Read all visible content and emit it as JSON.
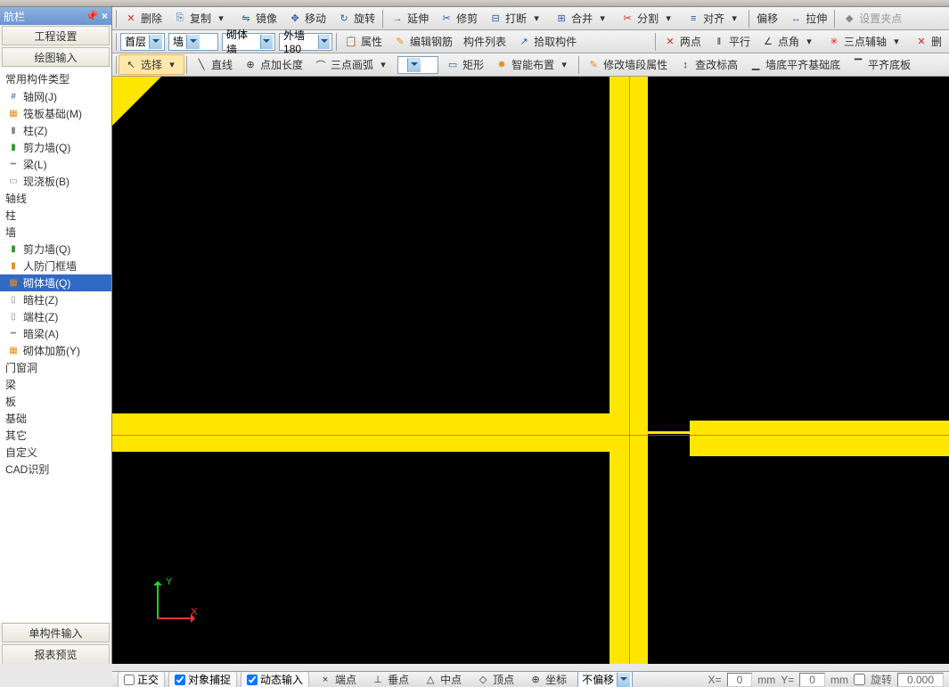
{
  "panel": {
    "title": "航栏",
    "btn_project": "工程设置",
    "btn_draw": "绘图输入",
    "btn_single": "单构件输入",
    "btn_report": "报表预览"
  },
  "tree": {
    "heading": "常用构件类型",
    "items": [
      {
        "icon": "#",
        "label": "轴网(J)",
        "color": "blue"
      },
      {
        "icon": "▦",
        "label": "筏板基础(M)",
        "color": "orange"
      },
      {
        "icon": "▮",
        "label": "柱(Z)",
        "color": "gray"
      },
      {
        "icon": "▮",
        "label": "剪力墙(Q)",
        "color": "green"
      },
      {
        "icon": "━",
        "label": "梁(L)",
        "color": "gray"
      },
      {
        "icon": "▭",
        "label": "现浇板(B)",
        "color": "gray"
      }
    ],
    "cats": [
      "轴线",
      "柱",
      "墙"
    ],
    "wall_items": [
      {
        "icon": "▮",
        "label": "剪力墙(Q)",
        "color": "green"
      },
      {
        "icon": "▮",
        "label": "人防门框墙",
        "color": "orange"
      },
      {
        "icon": "▦",
        "label": "砌体墙(Q)",
        "color": "orange",
        "selected": true
      },
      {
        "icon": "▯",
        "label": "暗柱(Z)",
        "color": "gray"
      },
      {
        "icon": "▯",
        "label": "端柱(Z)",
        "color": "gray"
      },
      {
        "icon": "━",
        "label": "暗梁(A)",
        "color": "gray"
      },
      {
        "icon": "▦",
        "label": "砌体加筋(Y)",
        "color": "orange"
      }
    ],
    "cats2": [
      "门窗洞",
      "梁",
      "板",
      "基础",
      "其它",
      "自定义",
      "CAD识别"
    ]
  },
  "tb1": {
    "delete": "删除",
    "copy": "复制",
    "mirror": "镜像",
    "move": "移动",
    "rotate": "旋转",
    "extend": "延伸",
    "trim": "修剪",
    "break": "打断",
    "merge": "合并",
    "split": "分割",
    "align": "对齐",
    "offset": "偏移",
    "stretch": "拉伸",
    "setpoint": "设置夹点"
  },
  "tb2": {
    "floor": "首层",
    "cat": "墙",
    "type": "砌体墙",
    "inst": "外墙180",
    "prop": "属性",
    "editrebar": "编辑钢筋",
    "list": "构件列表",
    "pick": "拾取构件",
    "twopt": "两点",
    "parallel": "平行",
    "pointangle": "点角",
    "threeaxis": "三点辅轴",
    "del": "删"
  },
  "tb3": {
    "select": "选择",
    "line": "直线",
    "pointlen": "点加长度",
    "arc3": "三点画弧",
    "rect": "矩形",
    "smart": "智能布置",
    "editseg": "修改墙段属性",
    "checkelev": "查改标高",
    "wallbase": "墙底平齐基础底",
    "wallslab": "平齐底板"
  },
  "status": {
    "ortho": "正交",
    "snap": "对象捕捉",
    "dyn": "动态输入",
    "endpoint": "端点",
    "perp": "垂点",
    "mid": "中点",
    "vertex": "顶点",
    "coord": "坐标",
    "nooffset": "不偏移",
    "x": "X=",
    "y": "Y=",
    "mm": "mm",
    "rotate": "旋转",
    "zero": "0",
    "zerodec": "0.000"
  },
  "axis": {
    "x": "X",
    "y": "Y"
  }
}
